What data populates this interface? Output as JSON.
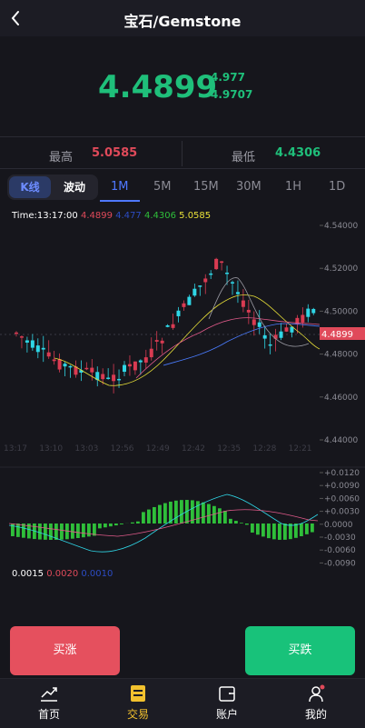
{
  "header": {
    "title": "宝石/Gemstone"
  },
  "price": {
    "current": "4.4899",
    "sub_top": "4.977",
    "sub_bottom": "4.9707"
  },
  "stats": {
    "high_label": "最高",
    "high_value": "5.0585",
    "low_label": "最低",
    "low_value": "4.4306"
  },
  "chart_tabs": {
    "kline_label": "K线",
    "wave_label": "波动",
    "intervals": [
      "1M",
      "5M",
      "15M",
      "30M",
      "1H",
      "1D"
    ],
    "active_interval": "1M"
  },
  "legend": {
    "time": "Time:13:17:00",
    "v1": "4.4899",
    "v2": "4.477",
    "v3": "4.4306",
    "v4": "5.0585"
  },
  "macd_legend": {
    "v1": "0.0015",
    "v2": "0.0020",
    "v3": "0.0010"
  },
  "colors": {
    "up": "#1fbf7a",
    "down": "#e04a5a",
    "candle_up": "#2fd6e6",
    "candle_down": "#d93b52",
    "accent": "#4f78ff",
    "nav_active": "#f2c12e"
  },
  "chart_data": {
    "type": "candlestick",
    "price_axis": [
      "4.54000",
      "4.52000",
      "4.50000",
      "4.48000",
      "4.46000",
      "4.44000"
    ],
    "price_ylim": [
      4.44,
      4.54
    ],
    "last_price_tag": "4.4899",
    "time_axis": [
      "13:17",
      "13:10",
      "13:03",
      "12:56",
      "12:49",
      "12:42",
      "12:35",
      "12:28",
      "12:21"
    ],
    "macd_axis": [
      "+0.0120",
      "+0.0090",
      "+0.0060",
      "+0.0030",
      "0.0000",
      "-0.0030",
      "-0.0060",
      "-0.0090"
    ],
    "macd_ylim": [
      -0.0105,
      0.0135
    ]
  },
  "actions": {
    "buy_label": "买涨",
    "sell_label": "买跌"
  },
  "nav": [
    {
      "label": "首页",
      "icon": "chart-line-icon"
    },
    {
      "label": "交易",
      "icon": "trade-icon"
    },
    {
      "label": "账户",
      "icon": "wallet-icon"
    },
    {
      "label": "我的",
      "icon": "user-icon"
    }
  ]
}
